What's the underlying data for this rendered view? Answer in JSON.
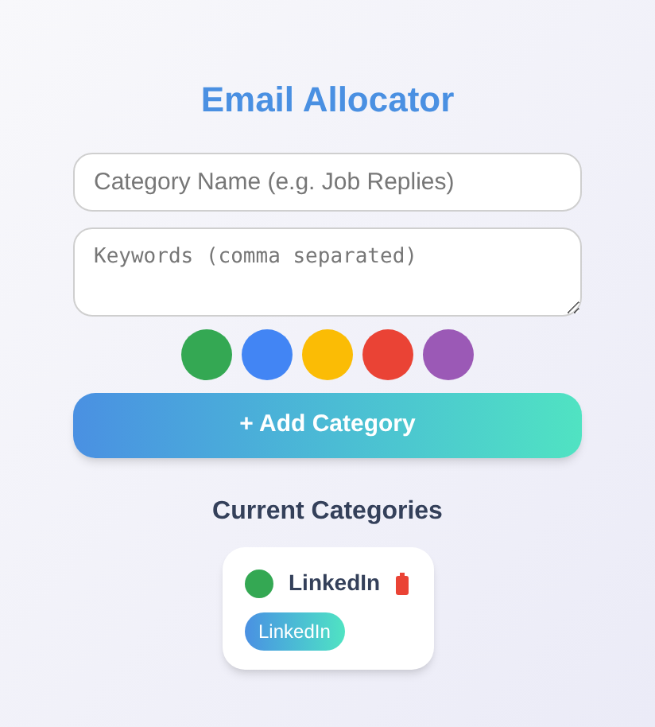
{
  "title": "Email Allocator",
  "name_field": {
    "placeholder": "Category Name (e.g. Job Replies)"
  },
  "keywords_field": {
    "placeholder": "Keywords (comma separated)"
  },
  "swatches": [
    {
      "color": "#34a853"
    },
    {
      "color": "#4285f4"
    },
    {
      "color": "#fbbc05"
    },
    {
      "color": "#ea4335"
    },
    {
      "color": "#9b59b6"
    }
  ],
  "add_button": "+ Add Category",
  "section_title": "Current Categories",
  "categories": [
    {
      "name": "LinkedIn",
      "color": "#34a853",
      "keywords": [
        "LinkedIn"
      ]
    }
  ]
}
